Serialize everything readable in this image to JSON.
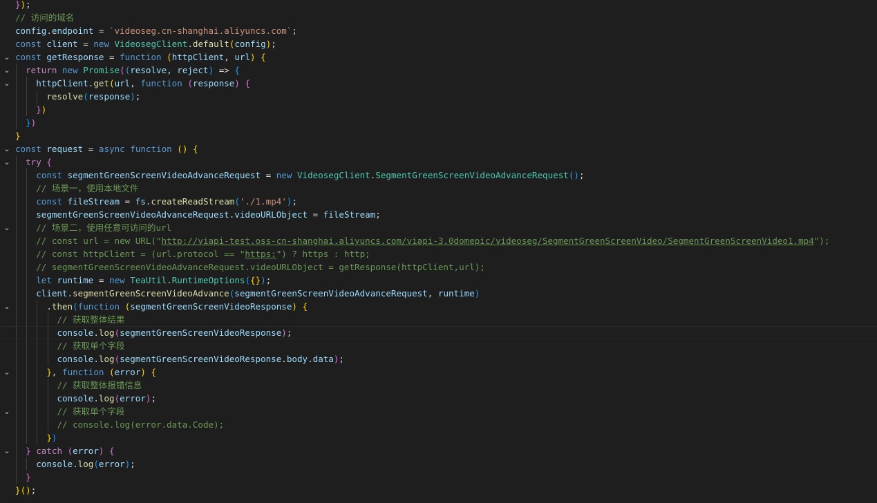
{
  "editor": {
    "language": "javascript",
    "theme_colors": {
      "background": "#1e1e1e",
      "keyword": "#569cd6",
      "control": "#c586c0",
      "variable": "#9cdcfe",
      "function": "#dcdcaa",
      "class": "#4ec9b0",
      "string": "#ce9178",
      "comment": "#6a9955",
      "punctuation": "#d4d4d4",
      "bracket_1": "#ffd700",
      "bracket_2": "#da70d6",
      "bracket_3": "#179fff"
    },
    "fold_icon": "chevron-down-icon",
    "current_line": 25,
    "lines": [
      {
        "text": "});",
        "fold": false,
        "indent": 0
      },
      {
        "text": "// 访问的域名",
        "fold": false,
        "indent": 0
      },
      {
        "text": "config.endpoint = `videoseg.cn-shanghai.aliyuncs.com`;",
        "fold": false,
        "indent": 0
      },
      {
        "text": "const client = new VideosegClient.default(config);",
        "fold": false,
        "indent": 0
      },
      {
        "text": "const getResponse = function (httpClient, url) {",
        "fold": true,
        "indent": 0
      },
      {
        "text": "  return new Promise((resolve, reject) => {",
        "fold": true,
        "indent": 1
      },
      {
        "text": "    httpClient.get(url, function (response) {",
        "fold": true,
        "indent": 2
      },
      {
        "text": "      resolve(response);",
        "fold": false,
        "indent": 3
      },
      {
        "text": "    })",
        "fold": false,
        "indent": 2
      },
      {
        "text": "  })",
        "fold": false,
        "indent": 1
      },
      {
        "text": "}",
        "fold": false,
        "indent": 0
      },
      {
        "text": "const request = async function () {",
        "fold": true,
        "indent": 0
      },
      {
        "text": "  try {",
        "fold": true,
        "indent": 1
      },
      {
        "text": "    const segmentGreenScreenVideoAdvanceRequest = new VideosegClient.SegmentGreenScreenVideoAdvanceRequest();",
        "fold": false,
        "indent": 2
      },
      {
        "text": "    // 场景一，使用本地文件",
        "fold": false,
        "indent": 2
      },
      {
        "text": "    const fileStream = fs.createReadStream('./1.mp4');",
        "fold": false,
        "indent": 2
      },
      {
        "text": "    segmentGreenScreenVideoAdvanceRequest.videoURLObject = fileStream;",
        "fold": false,
        "indent": 2
      },
      {
        "text": "    // 场景二，使用任意可访问的url",
        "fold": true,
        "indent": 2
      },
      {
        "text": "    // const url = new URL(\"http://viapi-test.oss-cn-shanghai.aliyuncs.com/viapi-3.0domepic/videoseg/SegmentGreenScreenVideo/SegmentGreenScreenVideo1.mp4\");",
        "fold": false,
        "indent": 2
      },
      {
        "text": "    // const httpClient = (url.protocol == \"https:\") ? https : http;",
        "fold": false,
        "indent": 2
      },
      {
        "text": "    // segmentGreenScreenVideoAdvanceRequest.videoURLObject = getResponse(httpClient,url);",
        "fold": false,
        "indent": 2
      },
      {
        "text": "    let runtime = new TeaUtil.RuntimeOptions({});",
        "fold": false,
        "indent": 2
      },
      {
        "text": "    client.segmentGreenScreenVideoAdvance(segmentGreenScreenVideoAdvanceRequest, runtime)",
        "fold": false,
        "indent": 2
      },
      {
        "text": "      .then(function (segmentGreenScreenVideoResponse) {",
        "fold": true,
        "indent": 3
      },
      {
        "text": "        // 获取整体结果",
        "fold": false,
        "indent": 4
      },
      {
        "text": "        console.log(segmentGreenScreenVideoResponse);",
        "fold": false,
        "indent": 4
      },
      {
        "text": "        // 获取单个字段",
        "fold": false,
        "indent": 4
      },
      {
        "text": "        console.log(segmentGreenScreenVideoResponse.body.data);",
        "fold": false,
        "indent": 4
      },
      {
        "text": "      }, function (error) {",
        "fold": true,
        "indent": 3
      },
      {
        "text": "        // 获取整体报错信息",
        "fold": false,
        "indent": 4
      },
      {
        "text": "        console.log(error);",
        "fold": false,
        "indent": 4
      },
      {
        "text": "        // 获取单个字段",
        "fold": true,
        "indent": 4
      },
      {
        "text": "        // console.log(error.data.Code);",
        "fold": false,
        "indent": 4
      },
      {
        "text": "      })",
        "fold": false,
        "indent": 3
      },
      {
        "text": "  } catch (error) {",
        "fold": true,
        "indent": 1
      },
      {
        "text": "    console.log(error);",
        "fold": false,
        "indent": 2
      },
      {
        "text": "  }",
        "fold": false,
        "indent": 1
      },
      {
        "text": "}();",
        "fold": false,
        "indent": 0
      }
    ]
  }
}
